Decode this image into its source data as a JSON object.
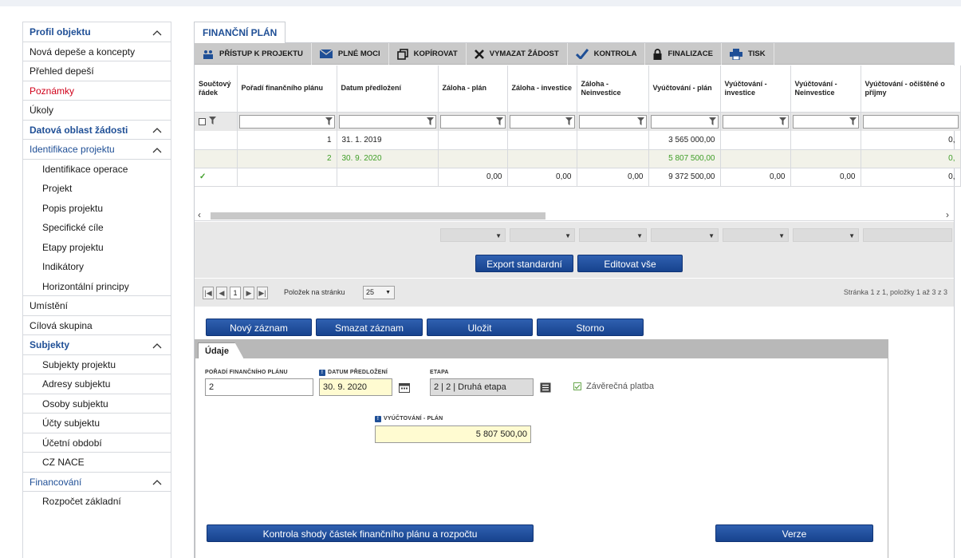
{
  "sidebar": {
    "items": [
      {
        "label": "Profil objektu",
        "type": "header"
      },
      {
        "label": "Nová depeše a koncepty",
        "type": "item"
      },
      {
        "label": "Přehled depeší",
        "type": "item"
      },
      {
        "label": "Poznámky",
        "type": "item-red"
      },
      {
        "label": "Úkoly",
        "type": "item"
      },
      {
        "label": "Datová oblast žádosti",
        "type": "header"
      },
      {
        "label": "Identifikace projektu",
        "type": "header-plain"
      },
      {
        "label": "Identifikace operace",
        "type": "sub"
      },
      {
        "label": "Projekt",
        "type": "sub"
      },
      {
        "label": "Popis projektu",
        "type": "sub"
      },
      {
        "label": "Specifické cíle",
        "type": "sub"
      },
      {
        "label": "Etapy projektu",
        "type": "sub"
      },
      {
        "label": "Indikátory",
        "type": "sub"
      },
      {
        "label": "Horizontální principy",
        "type": "sub"
      },
      {
        "label": "Umístění",
        "type": "item"
      },
      {
        "label": "Cílová skupina",
        "type": "item"
      },
      {
        "label": "Subjekty",
        "type": "header"
      },
      {
        "label": "Subjekty projektu",
        "type": "sub"
      },
      {
        "label": "Adresy subjektu",
        "type": "sub"
      },
      {
        "label": "Osoby subjektu",
        "type": "sub"
      },
      {
        "label": "Účty subjektu",
        "type": "sub"
      },
      {
        "label": "Účetní období",
        "type": "sub"
      },
      {
        "label": "CZ NACE",
        "type": "sub"
      },
      {
        "label": "Financování",
        "type": "header-plain"
      },
      {
        "label": "Rozpočet základní",
        "type": "sub"
      }
    ]
  },
  "main": {
    "tab_label": "FINANČNÍ PLÁN",
    "toolbar": [
      {
        "label": "PŘÍSTUP K PROJEKTU",
        "icon": "people-icon"
      },
      {
        "label": "PLNÉ MOCI",
        "icon": "mail-icon"
      },
      {
        "label": "KOPÍROVAT",
        "icon": "copy-icon"
      },
      {
        "label": "VYMAZAT ŽÁDOST",
        "icon": "delete-icon"
      },
      {
        "label": "KONTROLA",
        "icon": "check-icon"
      },
      {
        "label": "FINALIZACE",
        "icon": "lock-icon"
      },
      {
        "label": "TISK",
        "icon": "print-icon"
      }
    ],
    "grid": {
      "columns": [
        "Součtový řádek",
        "Pořadí finančního plánu",
        "Datum předložení",
        "Záloha - plán",
        "Záloha - investice",
        "Záloha - Neinvestice",
        "Vyúčtování - plán",
        "Vyúčtování - investice",
        "Vyúčtování - Neinvestice",
        "Vyúčtování - očištěné o příjmy"
      ],
      "rows": [
        {
          "sum": "",
          "order": "1",
          "date": "31. 1. 2019",
          "zp": "",
          "zi": "",
          "zn": "",
          "vp": "3 565 000,00",
          "vi": "",
          "vn": "",
          "vo": "0,"
        },
        {
          "sum": "",
          "order": "2",
          "date": "30. 9. 2020",
          "zp": "",
          "zi": "",
          "zn": "",
          "vp": "5 807 500,00",
          "vi": "",
          "vn": "",
          "vo": "0,"
        },
        {
          "sum": "✓",
          "order": "",
          "date": "",
          "zp": "0,00",
          "zi": "0,00",
          "zn": "0,00",
          "vp": "9 372 500,00",
          "vi": "0,00",
          "vn": "0,00",
          "vo": "0,"
        }
      ]
    },
    "buttons": {
      "export": "Export standardní",
      "edit_all": "Editovat vše",
      "new": "Nový záznam",
      "delete": "Smazat záznam",
      "save": "Uložit",
      "cancel": "Storno",
      "check_sums": "Kontrola shody částek finančního plánu a rozpočtu",
      "versions": "Verze"
    },
    "pager": {
      "page": "1",
      "per_page_label": "Položek na stránku",
      "per_page": "25",
      "info": "Stránka 1 z 1, položky 1 až 3 z 3"
    },
    "form": {
      "tab": "Údaje",
      "order_label": "POŘADÍ FINANČNÍHO PLÁNU",
      "order_value": "2",
      "date_label": "DATUM PŘEDLOŽENÍ",
      "date_value": "30. 9. 2020",
      "stage_label": "ETAPA",
      "stage_value": "2 | 2 | Druhá etapa",
      "final_payment_label": "Závěrečná platba",
      "final_payment_checked": true,
      "settlement_label": "VYÚČTOVÁNÍ - PLÁN",
      "settlement_value": "5 807 500,00"
    }
  },
  "colors": {
    "accent": "#1f4f96",
    "button": "#1f4f96",
    "green": "#3f9e27",
    "red": "#d0021b"
  }
}
